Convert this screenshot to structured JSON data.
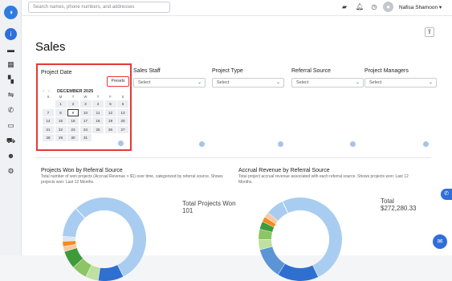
{
  "topbar": {
    "search_placeholder": "Search names, phone numbers, and addresses",
    "user_name": "Nafisa Shamoon",
    "avatar_initial": "👤"
  },
  "page": {
    "title": "Sales"
  },
  "filters": [
    {
      "label": "Sales Staff",
      "value": "Select"
    },
    {
      "label": "Project Type",
      "value": "Select"
    },
    {
      "label": "Referral Source",
      "value": "Select"
    },
    {
      "label": "Project Managers",
      "value": "Select"
    }
  ],
  "date_picker": {
    "label": "Project Date",
    "presets_label": "Presets",
    "month_title": "DECEMBER 2025",
    "weekdays": [
      "S",
      "M",
      "T",
      "W",
      "T",
      "F",
      "S"
    ],
    "weeks": [
      [
        "",
        "1",
        "2",
        "3",
        "4",
        "5",
        "6"
      ],
      [
        "7",
        "8",
        "9",
        "10",
        "11",
        "12",
        "13"
      ],
      [
        "14",
        "15",
        "16",
        "17",
        "18",
        "19",
        "20"
      ],
      [
        "21",
        "22",
        "23",
        "24",
        "25",
        "26",
        "27"
      ],
      [
        "28",
        "29",
        "30",
        "31",
        "",
        "",
        ""
      ]
    ],
    "selected_day": "9"
  },
  "cards": [
    {
      "title": "Projects Won by Referral Source",
      "subtitle": "Total number of won projects (Accrual Revenue > $1) over time, categorized by referral source. Shows projects won: Last 12 Months.",
      "total_label": "Total Projects Won",
      "total_value": "101",
      "slices": [
        {
          "value": 55,
          "color": "#a9cdf0"
        },
        {
          "value": 10,
          "color": "#2e6fd0"
        },
        {
          "value": 5,
          "color": "#bfe0a0"
        },
        {
          "value": 6,
          "color": "#8cc563"
        },
        {
          "value": 7,
          "color": "#3f9a3a"
        },
        {
          "value": 2,
          "color": "#f9c8a0"
        },
        {
          "value": 2,
          "color": "#f58a1f"
        },
        {
          "value": 2,
          "color": "#dfe6ef"
        },
        {
          "value": 12,
          "color": "#a9cdf0"
        }
      ]
    },
    {
      "title": "Accrual Revenue by Referral Source",
      "subtitle": "Total project accrual revenue associated with each referral source. Shows projects won: Last 12 Months.",
      "total_label": "Total",
      "total_value": "$272,280.33",
      "slices": [
        {
          "value": 50,
          "color": "#a9cdf0"
        },
        {
          "value": 16,
          "color": "#2e6fd0"
        },
        {
          "value": 12,
          "color": "#5b95d6"
        },
        {
          "value": 4,
          "color": "#bfe0a0"
        },
        {
          "value": 4,
          "color": "#8cc563"
        },
        {
          "value": 3,
          "color": "#3f9a3a"
        },
        {
          "value": 2,
          "color": "#f58a1f"
        },
        {
          "value": 2,
          "color": "#f9c8a0"
        },
        {
          "value": 7,
          "color": "#a9cdf0"
        }
      ]
    }
  ],
  "colors": {
    "accent": "#2f6fda",
    "highlight_border": "#e53935"
  },
  "icons": {
    "sidebar": [
      "info-icon",
      "briefcase-icon",
      "calendar-icon",
      "map-icon",
      "handshake-icon",
      "phone-icon",
      "folder-icon",
      "truck-icon",
      "team-icon",
      "gear-icon"
    ],
    "topbar": [
      "chat-bubble-icon",
      "bell-icon",
      "clock-icon",
      "caret-down-icon"
    ]
  }
}
